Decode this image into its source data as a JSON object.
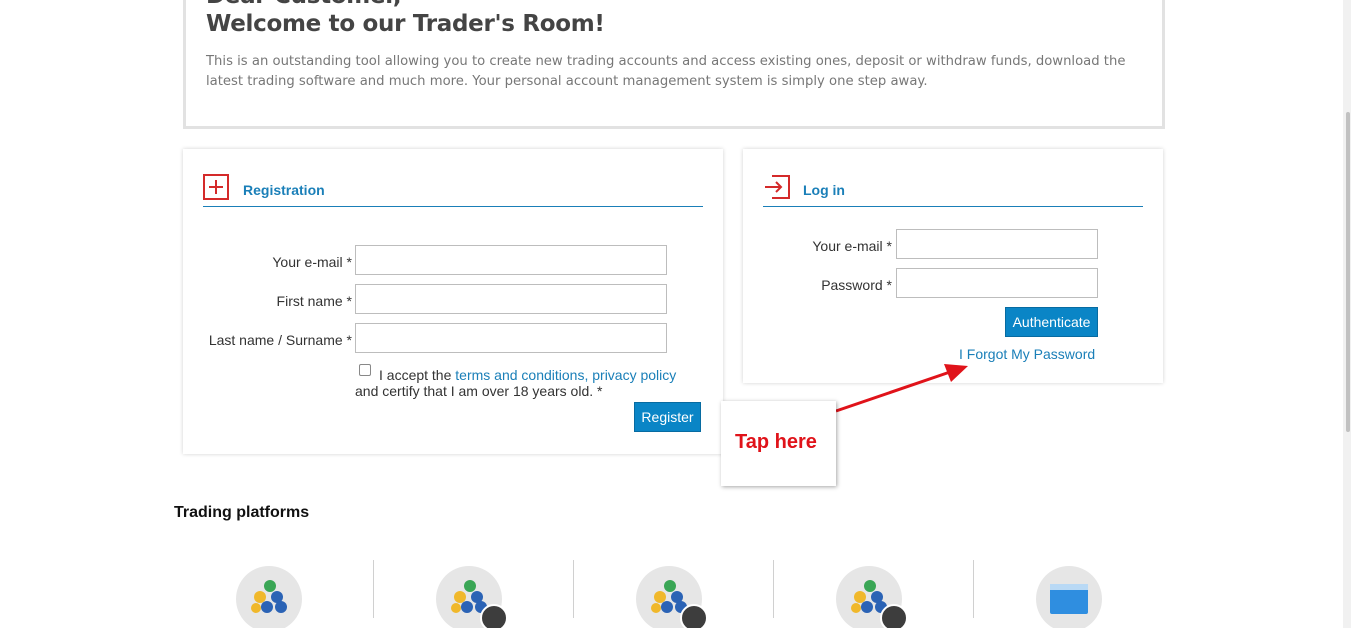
{
  "welcome": {
    "title_line1": "Dear Customer,",
    "title_line2": "Welcome to our Trader's Room!",
    "text": "This is an outstanding tool allowing you to create new trading accounts and access existing ones, deposit or withdraw funds, download the latest trading software and much more. Your personal account management system is simply one step away."
  },
  "registration": {
    "title": "Registration",
    "icon": "plus-icon",
    "email_label": "Your e-mail *",
    "first_name_label": "First name *",
    "last_name_label": "Last name / Surname *",
    "email_value": "",
    "first_name_value": "",
    "last_name_value": "",
    "accept_prefix": "I accept the ",
    "terms_link": "terms and conditions,",
    "privacy_link": "privacy policy",
    "certify_text": "and certify that I am over 18 years old. *",
    "accepted": false,
    "register_label": "Register"
  },
  "login": {
    "title": "Log in",
    "icon": "login-arrow-icon",
    "email_label": "Your e-mail *",
    "password_label": "Password *",
    "email_value": "",
    "password_value": "",
    "authenticate_label": "Authenticate",
    "forgot_label": "I Forgot My Password"
  },
  "callout": {
    "text": "Tap here"
  },
  "platforms": {
    "title": "Trading platforms",
    "items": [
      {
        "icon": "metatrader-icon",
        "badge": ""
      },
      {
        "icon": "metatrader-icon",
        "badge": "apple-icon"
      },
      {
        "icon": "metatrader-icon",
        "badge": "android-icon"
      },
      {
        "icon": "metatrader-icon",
        "badge": "apple-icon"
      },
      {
        "icon": "web-terminal-icon",
        "badge": ""
      }
    ]
  },
  "colors": {
    "accent": "#1a7fb8",
    "button": "#0a85c6",
    "icon_red": "#d42a2a",
    "callout_red": "#e0131a"
  }
}
